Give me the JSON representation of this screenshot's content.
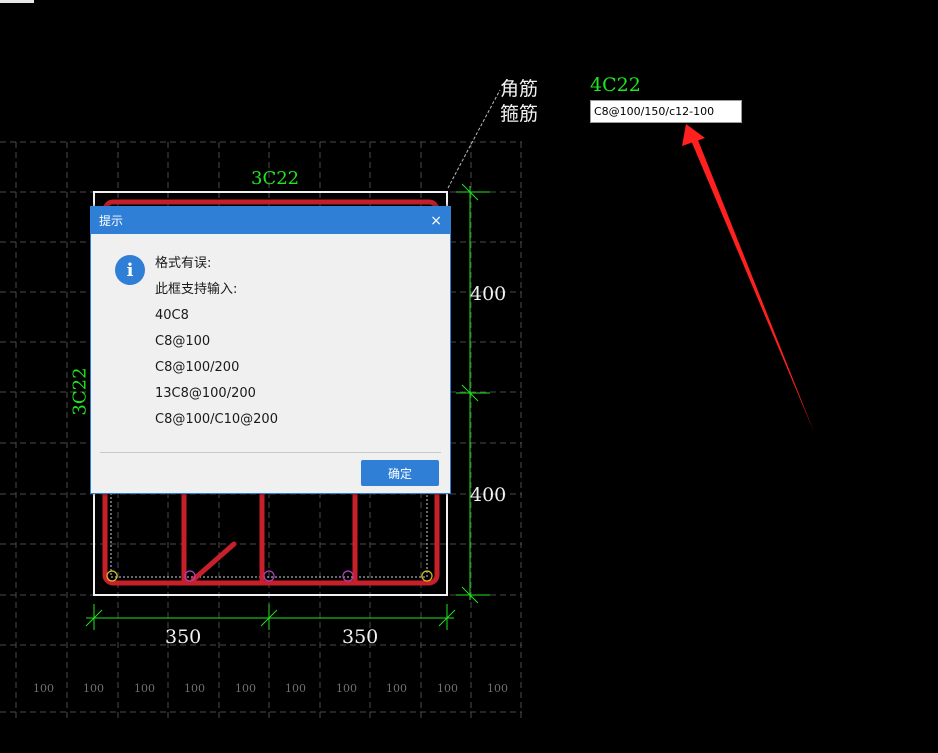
{
  "drawing": {
    "corner_bar_label": "角筋",
    "corner_bar_value": "4C22",
    "stirrup_label": "箍筋",
    "stirrup_input_value": "C8@100/150/c12-100",
    "top_bars": "3C22",
    "side_bars": "3C22",
    "dim_right_upper": "400",
    "dim_right_lower": "400",
    "dim_bottom_left": "350",
    "dim_bottom_right": "350",
    "grid_ticks": [
      "100",
      "100",
      "100",
      "100",
      "100",
      "100",
      "100",
      "100",
      "100",
      "100"
    ]
  },
  "dialog": {
    "title": "提示",
    "close_glyph": "×",
    "icon_glyph": "i",
    "lines": [
      "格式有误:",
      "此框支持输入:",
      "40C8",
      "C8@100",
      "C8@100/200",
      "13C8@100/200",
      "C8@100/C10@200"
    ],
    "ok_label": "确定"
  },
  "colors": {
    "background": "#000000",
    "rebar": "#c8202a",
    "dimension": "#1fe61f",
    "grid": "#4a4a4a",
    "dialog_accent": "#2f7fd6",
    "arrow": "#ff2020"
  }
}
